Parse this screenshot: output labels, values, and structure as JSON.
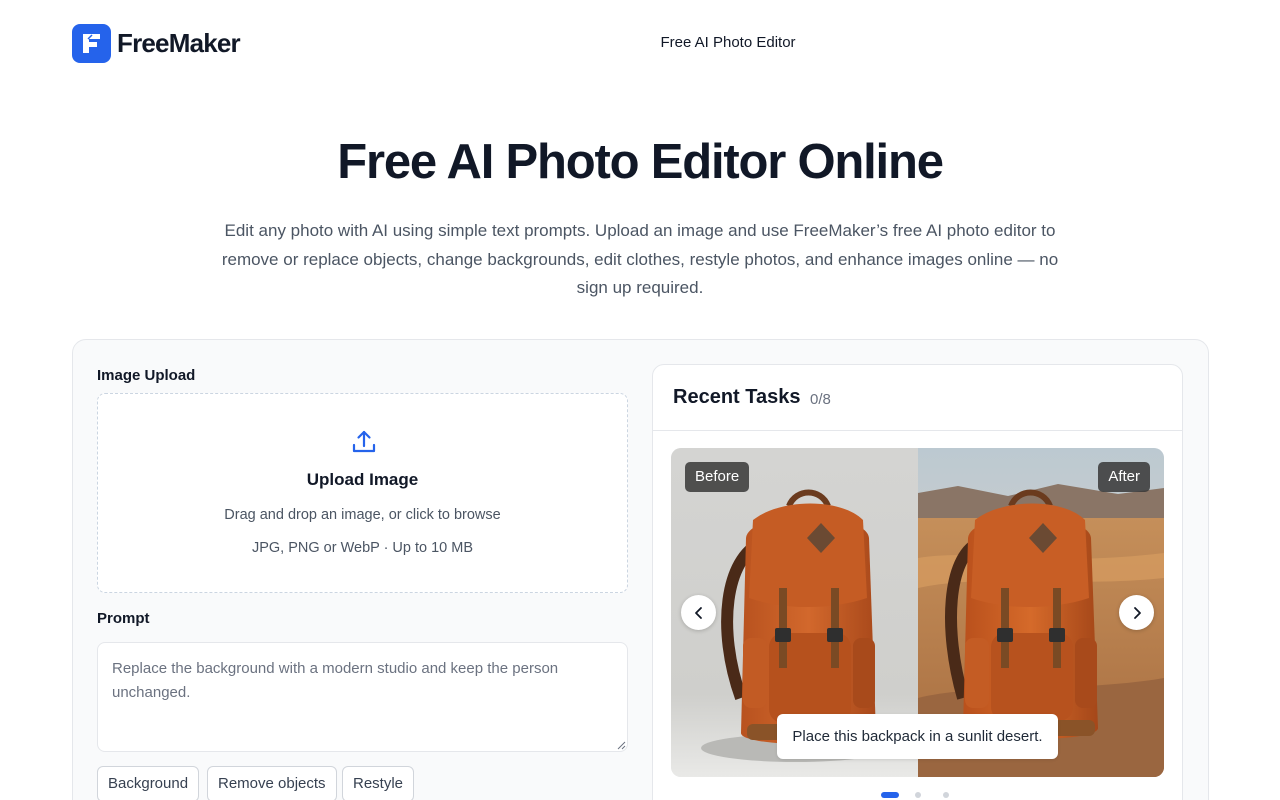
{
  "brand": {
    "name": "FreeMaker",
    "accent_color": "#2563eb"
  },
  "nav": {
    "link_label": "Free AI Photo Editor"
  },
  "hero": {
    "title": "Free AI Photo Editor Online",
    "description": "Edit any photo with AI using simple text prompts. Upload an image and use FreeMaker’s free AI photo editor to remove or replace objects, change backgrounds, edit clothes, restyle photos, and enhance images online — no sign up required."
  },
  "upload": {
    "section_label": "Image Upload",
    "title": "Upload Image",
    "hint": "Drag and drop an image, or click to browse",
    "formats": "JPG, PNG or WebP · Up to 10 MB",
    "icon": "upload-icon"
  },
  "prompt": {
    "section_label": "Prompt",
    "value": "",
    "placeholder": "Replace the background with a modern studio and keep the person unchanged."
  },
  "chips": [
    "Background",
    "Remove objects",
    "Restyle"
  ],
  "recent_tasks": {
    "title": "Recent Tasks",
    "count": "0/8",
    "carousel": {
      "before_label": "Before",
      "after_label": "After",
      "caption": "Place this backpack in a sunlit desert.",
      "active_slide": 1,
      "slide_count": 3,
      "prev_icon": "chevron-left-icon",
      "next_icon": "chevron-right-icon"
    }
  }
}
